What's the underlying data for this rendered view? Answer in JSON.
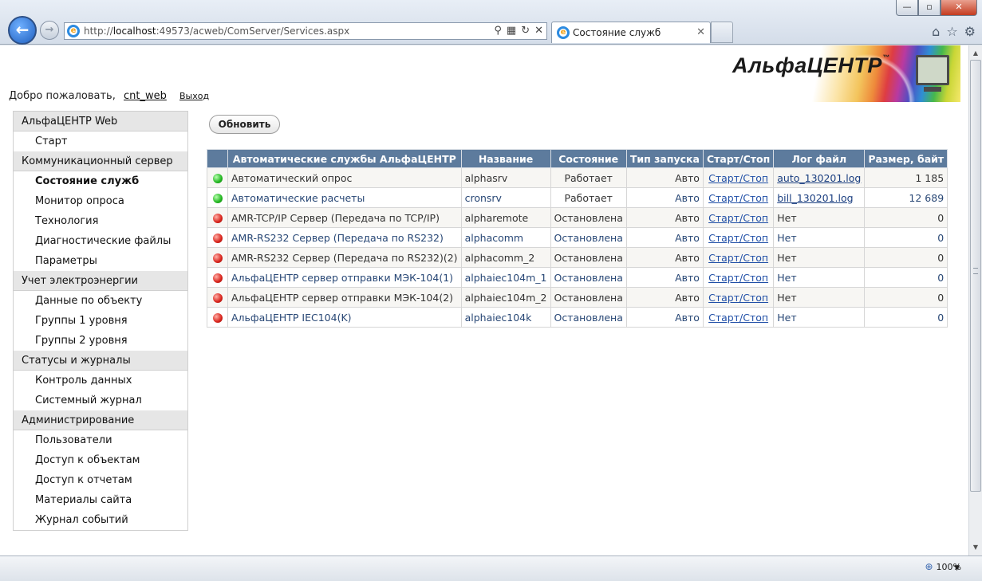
{
  "browser": {
    "url_prefix": "http://",
    "url_host": "localhost",
    "url_rest": ":49573/acweb/ComServer/Services.aspx",
    "tab_title": "Состояние служб",
    "zoom": "100%"
  },
  "logo": {
    "text": "АльфаЦЕНТР",
    "tm": "™"
  },
  "welcome": {
    "greeting": "Добро пожаловать,",
    "user": "cnt_web",
    "logout": "Выход"
  },
  "sidebar": {
    "sections": [
      {
        "title": "АльфаЦЕНТР Web",
        "items": [
          "Старт"
        ]
      },
      {
        "title": "Коммуникационный сервер",
        "items": [
          "Состояние служб",
          "Монитор опроса",
          "Технология",
          "Диагностические файлы",
          "Параметры"
        ]
      },
      {
        "title": "Учет электроэнергии",
        "items": [
          "Данные по объекту",
          "Группы 1 уровня",
          "Группы 2 уровня"
        ]
      },
      {
        "title": "Статусы и журналы",
        "items": [
          "Контроль данных",
          "Системный журнал"
        ]
      },
      {
        "title": "Администрирование",
        "items": [
          "Пользователи",
          "Доступ к объектам",
          "Доступ к отчетам",
          "Материалы сайта",
          "Журнал событий"
        ]
      }
    ],
    "active_item": "Состояние служб"
  },
  "main": {
    "refresh_label": "Обновить",
    "table": {
      "headers": [
        "",
        "Автоматические службы АльфаЦЕНТР",
        "Название",
        "Состояние",
        "Тип запуска",
        "Старт/Стоп",
        "Лог файл",
        "Размер, байт"
      ],
      "rows": [
        {
          "status": "green",
          "name": "Автоматический опрос",
          "code": "alphasrv",
          "state": "Работает",
          "start": "Авто",
          "ss": "Старт/Стоп",
          "log": "auto_130201.log",
          "size": "1 185"
        },
        {
          "status": "green",
          "name": "Автоматические расчеты",
          "code": "cronsrv",
          "state": "Работает",
          "start": "Авто",
          "ss": "Старт/Стоп",
          "log": "bill_130201.log",
          "size": "12 689"
        },
        {
          "status": "red",
          "name": "AMR-TCP/IP Сервер (Передача по TCP/IP)",
          "code": "alpharemote",
          "state": "Остановлена",
          "start": "Авто",
          "ss": "Старт/Стоп",
          "log": "Нет",
          "size": "0"
        },
        {
          "status": "red",
          "name": "AMR-RS232 Сервер (Передача по RS232)",
          "code": "alphacomm",
          "state": "Остановлена",
          "start": "Авто",
          "ss": "Старт/Стоп",
          "log": "Нет",
          "size": "0"
        },
        {
          "status": "red",
          "name": "AMR-RS232 Сервер (Передача по RS232)(2)",
          "code": "alphacomm_2",
          "state": "Остановлена",
          "start": "Авто",
          "ss": "Старт/Стоп",
          "log": "Нет",
          "size": "0"
        },
        {
          "status": "red",
          "name": "АльфаЦЕНТР сервер отправки МЭК-104(1)",
          "code": "alphaiec104m_1",
          "state": "Остановлена",
          "start": "Авто",
          "ss": "Старт/Стоп",
          "log": "Нет",
          "size": "0"
        },
        {
          "status": "red",
          "name": "АльфаЦЕНТР сервер отправки МЭК-104(2)",
          "code": "alphaiec104m_2",
          "state": "Остановлена",
          "start": "Авто",
          "ss": "Старт/Стоп",
          "log": "Нет",
          "size": "0"
        },
        {
          "status": "red",
          "name": "АльфаЦЕНТР IEC104(K)",
          "code": "alphaiec104k",
          "state": "Остановлена",
          "start": "Авто",
          "ss": "Старт/Стоп",
          "log": "Нет",
          "size": "0"
        }
      ]
    }
  }
}
